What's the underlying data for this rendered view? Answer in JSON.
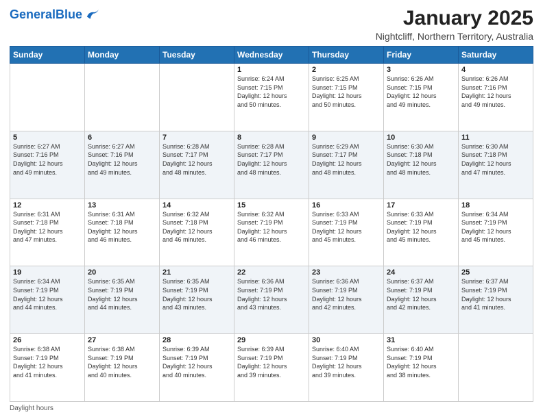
{
  "header": {
    "logo_text1": "General",
    "logo_text2": "Blue",
    "main_title": "January 2025",
    "sub_title": "Nightcliff, Northern Territory, Australia"
  },
  "days_of_week": [
    "Sunday",
    "Monday",
    "Tuesday",
    "Wednesday",
    "Thursday",
    "Friday",
    "Saturday"
  ],
  "weeks": [
    [
      {
        "day": "",
        "info": ""
      },
      {
        "day": "",
        "info": ""
      },
      {
        "day": "",
        "info": ""
      },
      {
        "day": "1",
        "info": "Sunrise: 6:24 AM\nSunset: 7:15 PM\nDaylight: 12 hours\nand 50 minutes."
      },
      {
        "day": "2",
        "info": "Sunrise: 6:25 AM\nSunset: 7:15 PM\nDaylight: 12 hours\nand 50 minutes."
      },
      {
        "day": "3",
        "info": "Sunrise: 6:26 AM\nSunset: 7:15 PM\nDaylight: 12 hours\nand 49 minutes."
      },
      {
        "day": "4",
        "info": "Sunrise: 6:26 AM\nSunset: 7:16 PM\nDaylight: 12 hours\nand 49 minutes."
      }
    ],
    [
      {
        "day": "5",
        "info": "Sunrise: 6:27 AM\nSunset: 7:16 PM\nDaylight: 12 hours\nand 49 minutes."
      },
      {
        "day": "6",
        "info": "Sunrise: 6:27 AM\nSunset: 7:16 PM\nDaylight: 12 hours\nand 49 minutes."
      },
      {
        "day": "7",
        "info": "Sunrise: 6:28 AM\nSunset: 7:17 PM\nDaylight: 12 hours\nand 48 minutes."
      },
      {
        "day": "8",
        "info": "Sunrise: 6:28 AM\nSunset: 7:17 PM\nDaylight: 12 hours\nand 48 minutes."
      },
      {
        "day": "9",
        "info": "Sunrise: 6:29 AM\nSunset: 7:17 PM\nDaylight: 12 hours\nand 48 minutes."
      },
      {
        "day": "10",
        "info": "Sunrise: 6:30 AM\nSunset: 7:18 PM\nDaylight: 12 hours\nand 48 minutes."
      },
      {
        "day": "11",
        "info": "Sunrise: 6:30 AM\nSunset: 7:18 PM\nDaylight: 12 hours\nand 47 minutes."
      }
    ],
    [
      {
        "day": "12",
        "info": "Sunrise: 6:31 AM\nSunset: 7:18 PM\nDaylight: 12 hours\nand 47 minutes."
      },
      {
        "day": "13",
        "info": "Sunrise: 6:31 AM\nSunset: 7:18 PM\nDaylight: 12 hours\nand 46 minutes."
      },
      {
        "day": "14",
        "info": "Sunrise: 6:32 AM\nSunset: 7:18 PM\nDaylight: 12 hours\nand 46 minutes."
      },
      {
        "day": "15",
        "info": "Sunrise: 6:32 AM\nSunset: 7:19 PM\nDaylight: 12 hours\nand 46 minutes."
      },
      {
        "day": "16",
        "info": "Sunrise: 6:33 AM\nSunset: 7:19 PM\nDaylight: 12 hours\nand 45 minutes."
      },
      {
        "day": "17",
        "info": "Sunrise: 6:33 AM\nSunset: 7:19 PM\nDaylight: 12 hours\nand 45 minutes."
      },
      {
        "day": "18",
        "info": "Sunrise: 6:34 AM\nSunset: 7:19 PM\nDaylight: 12 hours\nand 45 minutes."
      }
    ],
    [
      {
        "day": "19",
        "info": "Sunrise: 6:34 AM\nSunset: 7:19 PM\nDaylight: 12 hours\nand 44 minutes."
      },
      {
        "day": "20",
        "info": "Sunrise: 6:35 AM\nSunset: 7:19 PM\nDaylight: 12 hours\nand 44 minutes."
      },
      {
        "day": "21",
        "info": "Sunrise: 6:35 AM\nSunset: 7:19 PM\nDaylight: 12 hours\nand 43 minutes."
      },
      {
        "day": "22",
        "info": "Sunrise: 6:36 AM\nSunset: 7:19 PM\nDaylight: 12 hours\nand 43 minutes."
      },
      {
        "day": "23",
        "info": "Sunrise: 6:36 AM\nSunset: 7:19 PM\nDaylight: 12 hours\nand 42 minutes."
      },
      {
        "day": "24",
        "info": "Sunrise: 6:37 AM\nSunset: 7:19 PM\nDaylight: 12 hours\nand 42 minutes."
      },
      {
        "day": "25",
        "info": "Sunrise: 6:37 AM\nSunset: 7:19 PM\nDaylight: 12 hours\nand 41 minutes."
      }
    ],
    [
      {
        "day": "26",
        "info": "Sunrise: 6:38 AM\nSunset: 7:19 PM\nDaylight: 12 hours\nand 41 minutes."
      },
      {
        "day": "27",
        "info": "Sunrise: 6:38 AM\nSunset: 7:19 PM\nDaylight: 12 hours\nand 40 minutes."
      },
      {
        "day": "28",
        "info": "Sunrise: 6:39 AM\nSunset: 7:19 PM\nDaylight: 12 hours\nand 40 minutes."
      },
      {
        "day": "29",
        "info": "Sunrise: 6:39 AM\nSunset: 7:19 PM\nDaylight: 12 hours\nand 39 minutes."
      },
      {
        "day": "30",
        "info": "Sunrise: 6:40 AM\nSunset: 7:19 PM\nDaylight: 12 hours\nand 39 minutes."
      },
      {
        "day": "31",
        "info": "Sunrise: 6:40 AM\nSunset: 7:19 PM\nDaylight: 12 hours\nand 38 minutes."
      },
      {
        "day": "",
        "info": ""
      }
    ]
  ],
  "footer": {
    "note": "Daylight hours"
  }
}
